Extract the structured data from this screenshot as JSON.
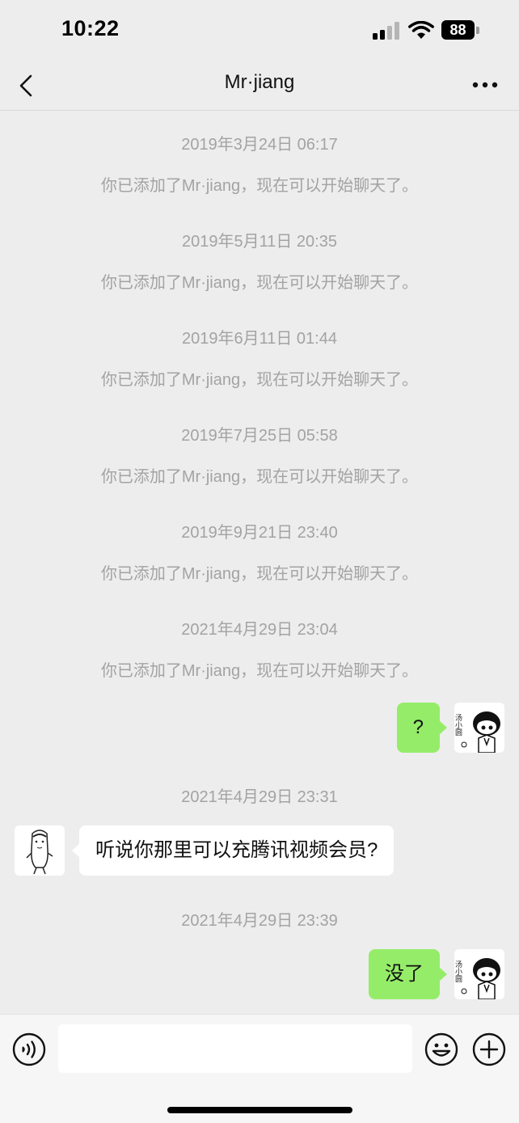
{
  "status_bar": {
    "time": "10:22",
    "battery": "88",
    "icons": [
      "signal-icon",
      "wifi-icon",
      "battery-icon"
    ]
  },
  "nav": {
    "title": "Mr·jiang",
    "back_icon": "chevron-left-icon",
    "more_icon": "more-dots-icon"
  },
  "messages": [
    {
      "type": "timestamp",
      "text": "2019年3月24日 06:17"
    },
    {
      "type": "system",
      "text": "你已添加了Mr·jiang，现在可以开始聊天了。"
    },
    {
      "type": "timestamp",
      "text": "2019年5月11日 20:35"
    },
    {
      "type": "system",
      "text": "你已添加了Mr·jiang，现在可以开始聊天了。"
    },
    {
      "type": "timestamp",
      "text": "2019年6月11日 01:44"
    },
    {
      "type": "system",
      "text": "你已添加了Mr·jiang，现在可以开始聊天了。"
    },
    {
      "type": "timestamp",
      "text": "2019年7月25日 05:58"
    },
    {
      "type": "system",
      "text": "你已添加了Mr·jiang，现在可以开始聊天了。"
    },
    {
      "type": "timestamp",
      "text": "2019年9月21日 23:40"
    },
    {
      "type": "system",
      "text": "你已添加了Mr·jiang，现在可以开始聊天了。"
    },
    {
      "type": "timestamp",
      "text": "2021年4月29日 23:04"
    },
    {
      "type": "system",
      "text": "你已添加了Mr·jiang，现在可以开始聊天了。"
    },
    {
      "type": "outgoing",
      "text": "?"
    },
    {
      "type": "timestamp",
      "text": "2021年4月29日 23:31"
    },
    {
      "type": "incoming",
      "text": "听说你那里可以充腾讯视频会员?"
    },
    {
      "type": "timestamp",
      "text": "2021年4月29日 23:39"
    },
    {
      "type": "outgoing",
      "text": "没了"
    }
  ],
  "my_avatar": {
    "text": "汤小圆"
  },
  "input_bar": {
    "placeholder": "",
    "icons": [
      "voice-icon",
      "emoji-icon",
      "plus-icon"
    ]
  },
  "colors": {
    "background": "#ededed",
    "outgoing_bubble": "#95ec69",
    "incoming_bubble": "#ffffff",
    "muted_text": "#a3a3a3"
  }
}
